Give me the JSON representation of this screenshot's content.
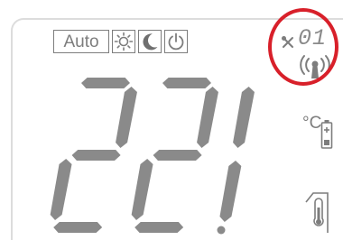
{
  "display": {
    "modes": {
      "auto_label": "Auto",
      "comfort_icon": "sun-icon",
      "eco_icon": "moon-icon",
      "power_icon": "power-icon"
    },
    "channel": {
      "icon": "wrench-icon",
      "value": "01",
      "signal_icon": "radio-signal-icon"
    },
    "temperature": {
      "value": "22.1",
      "unit": "°C"
    },
    "status_icons": {
      "battery": "battery-icon",
      "thermometer": "thermometer-icon"
    }
  },
  "colors": {
    "segment": "#8a8a8a",
    "outline": "#7d7d7d",
    "highlight": "#d8202a",
    "frame": "#dcdcdc"
  }
}
